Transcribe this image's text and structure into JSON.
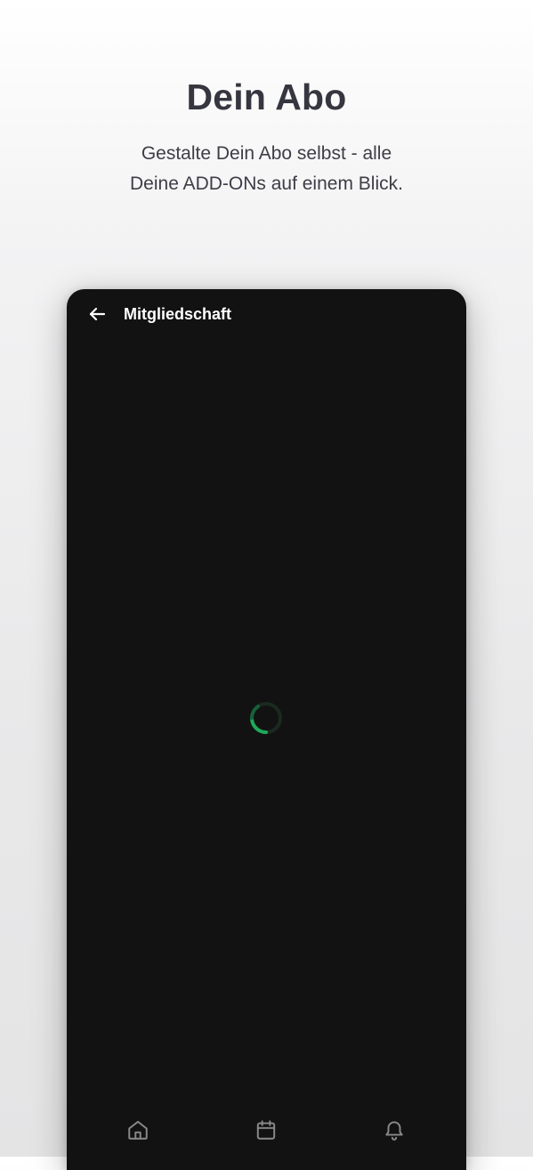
{
  "promo": {
    "title": "Dein Abo",
    "subtitle_line1": "Gestalte Dein Abo selbst - alle",
    "subtitle_line2": "Deine ADD-ONs auf einem Blick."
  },
  "screen": {
    "title": "Mitgliedschaft",
    "back_icon": "arrow-left-icon",
    "loading": true
  },
  "bottom_nav": {
    "items": [
      {
        "icon": "home-icon"
      },
      {
        "icon": "calendar-icon"
      },
      {
        "icon": "bell-icon"
      }
    ]
  },
  "colors": {
    "background": "#f0f0f1",
    "headline": "#363640",
    "phone_background": "#121212",
    "spinner_accent": "#1fa85a",
    "nav_icon": "#8a8a8a"
  }
}
